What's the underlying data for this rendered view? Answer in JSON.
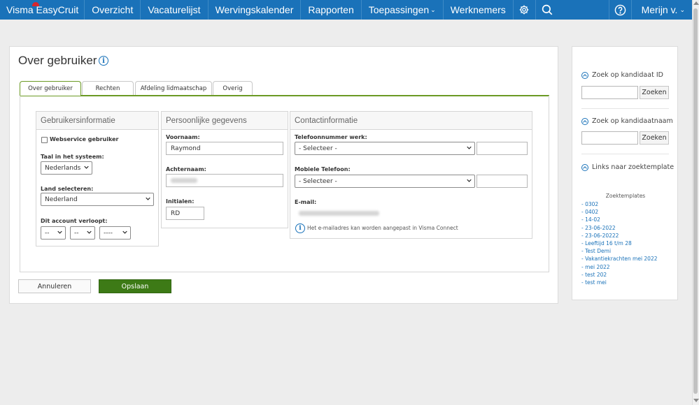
{
  "nav": {
    "brand": "Visma EasyCruit",
    "items": [
      {
        "label": "Overzicht"
      },
      {
        "label": "Vacaturelijst"
      },
      {
        "label": "Wervingskalender"
      },
      {
        "label": "Rapporten"
      },
      {
        "label": "Toepassingen",
        "caret": "⌄"
      },
      {
        "label": "Werknemers"
      }
    ],
    "user": "Merijn v.",
    "user_caret": "⌄",
    "icons": [
      "gear-icon",
      "search-icon",
      "help-icon"
    ]
  },
  "page": {
    "title": "Over gebruiker",
    "info_glyph": "i"
  },
  "tabs": [
    {
      "label": "Over gebruiker",
      "active": true
    },
    {
      "label": "Rechten",
      "active": false
    },
    {
      "label": "Afdeling lidmaatschap",
      "active": false
    },
    {
      "label": "Overig",
      "active": false
    }
  ],
  "gebruikersinformatie": {
    "header": "Gebruikersinformatie",
    "webservice_label": "Webservice gebruiker",
    "taal_label": "Taal in het systeem:",
    "taal_value": "Nederlands",
    "land_label": "Land selecteren:",
    "land_value": "Nederland",
    "verloopt_label": "Dit account verloopt:",
    "verloopt_day": "--",
    "verloopt_month": "--",
    "verloopt_year": "----"
  },
  "persoonlijk": {
    "header": "Persoonlijke gegevens",
    "voornaam_label": "Voornaam:",
    "voornaam_value": "Raymond",
    "achternaam_label": "Achternaam:",
    "initialen_label": "Initialen:",
    "initialen_value": "RD"
  },
  "contact": {
    "header": "Contactinformatie",
    "tel_werk_label": "Telefoonnummer werk:",
    "tel_werk_select": "- Selecteer -",
    "mobiel_label": "Mobiele Telefoon:",
    "mobiel_select": "- Selecteer -",
    "email_label": "E-mail:",
    "email_note": "Het e-mailadres kan worden aangepast in Visma Connect"
  },
  "buttons": {
    "cancel": "Annuleren",
    "save": "Opslaan"
  },
  "side": {
    "search_id_heading": "Zoek op kandidaat ID",
    "search_name_heading": "Zoek op kandidaatnaam",
    "search_button": "Zoeken",
    "links_heading": "Links naar zoektemplate",
    "templates_title": "Zoektemplates",
    "templates": [
      "- 0302",
      "- 0402",
      "- 14-02",
      "- 23-06-2022",
      "- 23-06-20222",
      "- Leeftijd 16 t/m 28",
      "- Test Demi",
      "- Vakantiekrachten mei 2022",
      "- mei 2022",
      "- test 202",
      "- test mei"
    ]
  },
  "colors": {
    "nav_blue": "#1a72b9",
    "accent_green": "#3d7a16",
    "tab_green": "#6b9a24",
    "link_blue": "#1a72b9"
  }
}
